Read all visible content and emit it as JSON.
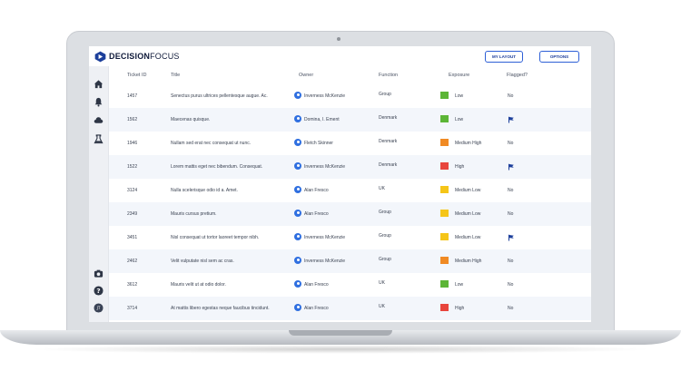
{
  "app": {
    "brand_bold": "DECISION",
    "brand_light": "FOCUS",
    "buttons": {
      "layout": "MY LAYOUT",
      "options": "OPTIONS"
    }
  },
  "colors": {
    "low": "#5cb536",
    "medium_low": "#f5c518",
    "medium_high": "#f08a24",
    "high": "#e8453c",
    "accent": "#2d5fd6"
  },
  "table": {
    "headers": {
      "id": "Ticket ID",
      "title": "Title",
      "owner": "Owner",
      "function": "Function",
      "exposure": "Exposure",
      "flagged": "Flagged?"
    },
    "rows": [
      {
        "id": "1457",
        "title": "Senectus purus ultrices pellentesque augue. Ac.",
        "owner": "Inverness McKenzie",
        "function": "Group",
        "exposure": "Low",
        "level": "low",
        "flagged": "No"
      },
      {
        "id": "1562",
        "title": "Maecenas quisque.",
        "owner": "Domina, I. Ement",
        "function": "Denmark",
        "exposure": "Low",
        "level": "low",
        "flagged": "flag"
      },
      {
        "id": "1946",
        "title": "Nullam sed erat nec consequat ut nunc.",
        "owner": "Fletch Skinner",
        "function": "Denmark",
        "exposure": "Medium High",
        "level": "medium_high",
        "flagged": "No"
      },
      {
        "id": "1522",
        "title": "Lorem mattis eget nec bibendum. Consequat.",
        "owner": "Inverness McKenzie",
        "function": "Denmark",
        "exposure": "High",
        "level": "high",
        "flagged": "flag"
      },
      {
        "id": "3124",
        "title": "Nulla scelerisque odio id a. Amet.",
        "owner": "Alan Fresco",
        "function": "UK",
        "exposure": "Medium Low",
        "level": "medium_low",
        "flagged": "No"
      },
      {
        "id": "2349",
        "title": "Mauris cursus pretium.",
        "owner": "Alan Fresco",
        "function": "Group",
        "exposure": "Medium Low",
        "level": "medium_low",
        "flagged": "No"
      },
      {
        "id": "3451",
        "title": "Nisl consequat ut tortor laoreet tempor nibh.",
        "owner": "Inverness McKenzie",
        "function": "Group",
        "exposure": "Medium Low",
        "level": "medium_low",
        "flagged": "flag"
      },
      {
        "id": "2462",
        "title": "Velit vulputate nisl sem ac cras.",
        "owner": "Inverness McKenzie",
        "function": "Group",
        "exposure": "Medium High",
        "level": "medium_high",
        "flagged": "No"
      },
      {
        "id": "3612",
        "title": "Mauris velit ut at odio dolor.",
        "owner": "Alan Fresco",
        "function": "UK",
        "exposure": "Low",
        "level": "low",
        "flagged": "No"
      },
      {
        "id": "3714",
        "title": "At mattis libero egestas neque faucibus tincidunt.",
        "owner": "Alan Fresco",
        "function": "UK",
        "exposure": "High",
        "level": "high",
        "flagged": "No"
      }
    ]
  },
  "sidebar": {
    "icons": [
      "home-icon",
      "bell-icon",
      "cloud-icon",
      "flask-icon"
    ],
    "bottom_icons": [
      "camera-icon",
      "help-icon",
      "user-avatar-icon"
    ],
    "avatar_initials": "JT"
  }
}
